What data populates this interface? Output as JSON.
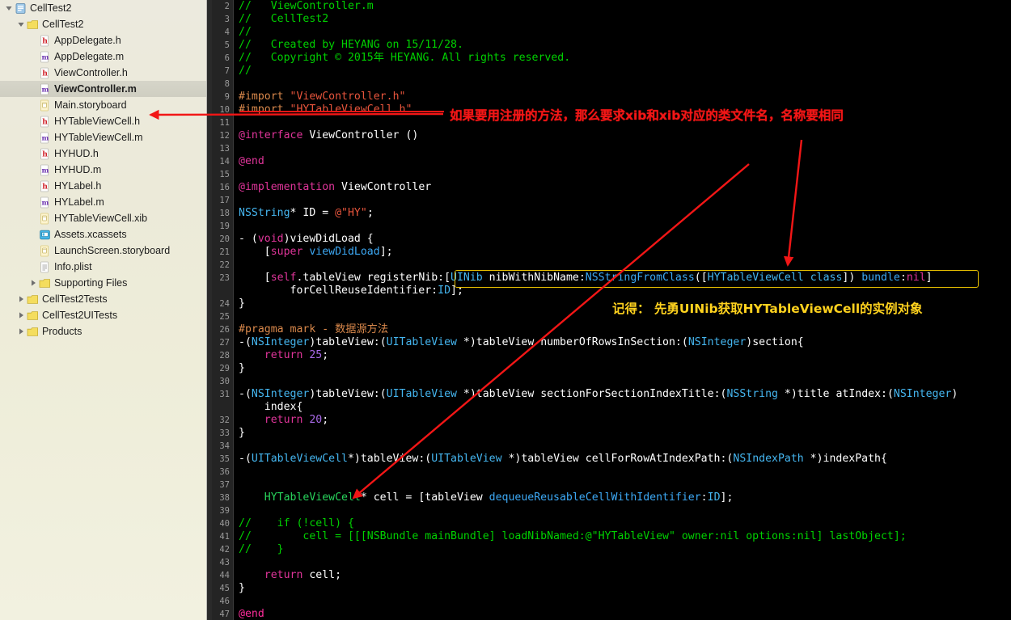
{
  "sidebar": {
    "items": [
      {
        "label": "CellTest2",
        "indent": 0,
        "twist": "down",
        "icon": "project-icon",
        "selected": false
      },
      {
        "label": "CellTest2",
        "indent": 1,
        "twist": "down",
        "icon": "folder-icon",
        "selected": false
      },
      {
        "label": "AppDelegate.h",
        "indent": 2,
        "twist": "none",
        "icon": "header-file-icon",
        "selected": false
      },
      {
        "label": "AppDelegate.m",
        "indent": 2,
        "twist": "none",
        "icon": "source-file-icon",
        "selected": false
      },
      {
        "label": "ViewController.h",
        "indent": 2,
        "twist": "none",
        "icon": "header-file-icon",
        "selected": false
      },
      {
        "label": "ViewController.m",
        "indent": 2,
        "twist": "none",
        "icon": "source-file-icon",
        "selected": true
      },
      {
        "label": "Main.storyboard",
        "indent": 2,
        "twist": "none",
        "icon": "storyboard-file-icon",
        "selected": false
      },
      {
        "label": "HYTableViewCell.h",
        "indent": 2,
        "twist": "none",
        "icon": "header-file-icon",
        "selected": false
      },
      {
        "label": "HYTableViewCell.m",
        "indent": 2,
        "twist": "none",
        "icon": "source-file-icon",
        "selected": false
      },
      {
        "label": "HYHUD.h",
        "indent": 2,
        "twist": "none",
        "icon": "header-file-icon",
        "selected": false
      },
      {
        "label": "HYHUD.m",
        "indent": 2,
        "twist": "none",
        "icon": "source-file-icon",
        "selected": false
      },
      {
        "label": "HYLabel.h",
        "indent": 2,
        "twist": "none",
        "icon": "header-file-icon",
        "selected": false
      },
      {
        "label": "HYLabel.m",
        "indent": 2,
        "twist": "none",
        "icon": "source-file-icon",
        "selected": false
      },
      {
        "label": "HYTableViewCell.xib",
        "indent": 2,
        "twist": "none",
        "icon": "xib-file-icon",
        "selected": false
      },
      {
        "label": "Assets.xcassets",
        "indent": 2,
        "twist": "none",
        "icon": "assets-catalog-icon",
        "selected": false
      },
      {
        "label": "LaunchScreen.storyboard",
        "indent": 2,
        "twist": "none",
        "icon": "storyboard-file-icon",
        "selected": false
      },
      {
        "label": "Info.plist",
        "indent": 2,
        "twist": "none",
        "icon": "plist-file-icon",
        "selected": false
      },
      {
        "label": "Supporting Files",
        "indent": 2,
        "twist": "right",
        "icon": "folder-icon",
        "selected": false
      },
      {
        "label": "CellTest2Tests",
        "indent": 1,
        "twist": "right",
        "icon": "folder-icon",
        "selected": false
      },
      {
        "label": "CellTest2UITests",
        "indent": 1,
        "twist": "right",
        "icon": "folder-icon",
        "selected": false
      },
      {
        "label": "Products",
        "indent": 1,
        "twist": "right",
        "icon": "folder-icon",
        "selected": false
      }
    ]
  },
  "editor": {
    "first_line_number": 2,
    "last_line_number": 47,
    "lines": [
      {
        "n": 2,
        "tokens": [
          {
            "t": "//   ViewController.m",
            "c": "c-com"
          }
        ]
      },
      {
        "n": 3,
        "tokens": [
          {
            "t": "//   CellTest2",
            "c": "c-com"
          }
        ]
      },
      {
        "n": 4,
        "tokens": [
          {
            "t": "//",
            "c": "c-com"
          }
        ]
      },
      {
        "n": 5,
        "tokens": [
          {
            "t": "//   Created by HEYANG on 15/11/28.",
            "c": "c-com"
          }
        ]
      },
      {
        "n": 6,
        "tokens": [
          {
            "t": "//   Copyright © 2015年 HEYANG. All rights reserved.",
            "c": "c-com"
          }
        ]
      },
      {
        "n": 7,
        "tokens": [
          {
            "t": "//",
            "c": "c-com"
          }
        ]
      },
      {
        "n": 8,
        "tokens": []
      },
      {
        "n": 9,
        "tokens": [
          {
            "t": "#import ",
            "c": "c-pre"
          },
          {
            "t": "\"ViewController.h\"",
            "c": "c-str"
          }
        ]
      },
      {
        "n": 10,
        "tokens": [
          {
            "t": "#import ",
            "c": "c-pre"
          },
          {
            "t": "\"HYTableViewCell.h\"",
            "c": "c-str"
          }
        ]
      },
      {
        "n": 11,
        "tokens": []
      },
      {
        "n": 12,
        "tokens": [
          {
            "t": "@interface ",
            "c": "c-kw"
          },
          {
            "t": "ViewController ()",
            "c": "c-plain"
          }
        ]
      },
      {
        "n": 13,
        "tokens": []
      },
      {
        "n": 14,
        "tokens": [
          {
            "t": "@end",
            "c": "c-kw"
          }
        ]
      },
      {
        "n": 15,
        "tokens": []
      },
      {
        "n": 16,
        "tokens": [
          {
            "t": "@implementation ",
            "c": "c-kw"
          },
          {
            "t": "ViewController",
            "c": "c-plain"
          }
        ]
      },
      {
        "n": 17,
        "tokens": []
      },
      {
        "n": 18,
        "tokens": [
          {
            "t": "NSString",
            "c": "c-type"
          },
          {
            "t": "* ID = ",
            "c": "c-plain"
          },
          {
            "t": "@\"HY\"",
            "c": "c-str"
          },
          {
            "t": ";",
            "c": "c-plain"
          }
        ]
      },
      {
        "n": 19,
        "tokens": []
      },
      {
        "n": 20,
        "tokens": [
          {
            "t": "- (",
            "c": "c-plain"
          },
          {
            "t": "void",
            "c": "c-kw"
          },
          {
            "t": ")viewDidLoad {",
            "c": "c-plain"
          }
        ]
      },
      {
        "n": 21,
        "tokens": [
          {
            "t": "    [",
            "c": "c-plain"
          },
          {
            "t": "super ",
            "c": "c-kw"
          },
          {
            "t": "viewDidLoad",
            "c": "c-meth"
          },
          {
            "t": "];",
            "c": "c-plain"
          }
        ]
      },
      {
        "n": 22,
        "tokens": []
      },
      {
        "n": 23,
        "tokens": [
          {
            "t": "    [",
            "c": "c-plain"
          },
          {
            "t": "self",
            "c": "c-kw"
          },
          {
            "t": ".tableView registerNib:[",
            "c": "c-plain"
          },
          {
            "t": "UINib",
            "c": "c-type"
          },
          {
            "t": " nibWithNibName:",
            "c": "c-plain"
          },
          {
            "t": "NSStringFromClass",
            "c": "c-meth"
          },
          {
            "t": "([",
            "c": "c-plain"
          },
          {
            "t": "HYTableViewCell class",
            "c": "c-type"
          },
          {
            "t": "]) ",
            "c": "c-plain"
          },
          {
            "t": "bundle",
            "c": "c-meth"
          },
          {
            "t": ":",
            "c": "c-plain"
          },
          {
            "t": "nil",
            "c": "c-kw"
          },
          {
            "t": "]",
            "c": "c-plain"
          }
        ]
      },
      {
        "n": 0,
        "tokens": [
          {
            "t": "        forCellReuseIdentifier:",
            "c": "c-plain"
          },
          {
            "t": "ID",
            "c": "c-type"
          },
          {
            "t": "];",
            "c": "c-plain"
          }
        ]
      },
      {
        "n": 24,
        "tokens": [
          {
            "t": "}",
            "c": "c-plain"
          }
        ]
      },
      {
        "n": 25,
        "tokens": []
      },
      {
        "n": 26,
        "tokens": [
          {
            "t": "#pragma mark - 数据源方法",
            "c": "c-pre"
          }
        ]
      },
      {
        "n": 27,
        "tokens": [
          {
            "t": "-(",
            "c": "c-plain"
          },
          {
            "t": "NSInteger",
            "c": "c-type"
          },
          {
            "t": ")tableView:(",
            "c": "c-plain"
          },
          {
            "t": "UITableView",
            "c": "c-type"
          },
          {
            "t": " *)tableView numberOfRowsInSection:(",
            "c": "c-plain"
          },
          {
            "t": "NSInteger",
            "c": "c-type"
          },
          {
            "t": ")section{",
            "c": "c-plain"
          }
        ]
      },
      {
        "n": 28,
        "tokens": [
          {
            "t": "    return ",
            "c": "c-kw"
          },
          {
            "t": "25",
            "c": "c-num"
          },
          {
            "t": ";",
            "c": "c-plain"
          }
        ]
      },
      {
        "n": 29,
        "tokens": [
          {
            "t": "}",
            "c": "c-plain"
          }
        ]
      },
      {
        "n": 30,
        "tokens": []
      },
      {
        "n": 31,
        "tokens": [
          {
            "t": "-(",
            "c": "c-plain"
          },
          {
            "t": "NSInteger",
            "c": "c-type"
          },
          {
            "t": ")tableView:(",
            "c": "c-plain"
          },
          {
            "t": "UITableView",
            "c": "c-type"
          },
          {
            "t": " *)tableView sectionForSectionIndexTitle:(",
            "c": "c-plain"
          },
          {
            "t": "NSString",
            "c": "c-type"
          },
          {
            "t": " *)title atIndex:(",
            "c": "c-plain"
          },
          {
            "t": "NSInteger",
            "c": "c-type"
          },
          {
            "t": ")",
            "c": "c-plain"
          }
        ]
      },
      {
        "n": 0,
        "tokens": [
          {
            "t": "    index{",
            "c": "c-plain"
          }
        ]
      },
      {
        "n": 32,
        "tokens": [
          {
            "t": "    return ",
            "c": "c-kw"
          },
          {
            "t": "20",
            "c": "c-num"
          },
          {
            "t": ";",
            "c": "c-plain"
          }
        ]
      },
      {
        "n": 33,
        "tokens": [
          {
            "t": "}",
            "c": "c-plain"
          }
        ]
      },
      {
        "n": 34,
        "tokens": []
      },
      {
        "n": 35,
        "tokens": [
          {
            "t": "-(",
            "c": "c-plain"
          },
          {
            "t": "UITableViewCell",
            "c": "c-type"
          },
          {
            "t": "*)tableView:(",
            "c": "c-plain"
          },
          {
            "t": "UITableView",
            "c": "c-type"
          },
          {
            "t": " *)tableView cellForRowAtIndexPath:(",
            "c": "c-plain"
          },
          {
            "t": "NSIndexPath",
            "c": "c-type"
          },
          {
            "t": " *)indexPath{",
            "c": "c-plain"
          }
        ]
      },
      {
        "n": 36,
        "tokens": []
      },
      {
        "n": 37,
        "tokens": []
      },
      {
        "n": 38,
        "tokens": [
          {
            "t": "    ",
            "c": "c-plain"
          },
          {
            "t": "HYTableViewCell",
            "c": "c-green"
          },
          {
            "t": "* cell = [tableView ",
            "c": "c-plain"
          },
          {
            "t": "dequeueReusableCellWithIdentifier",
            "c": "c-meth"
          },
          {
            "t": ":",
            "c": "c-plain"
          },
          {
            "t": "ID",
            "c": "c-type"
          },
          {
            "t": "];",
            "c": "c-plain"
          }
        ]
      },
      {
        "n": 39,
        "tokens": []
      },
      {
        "n": 40,
        "tokens": [
          {
            "t": "//    if (!cell) {",
            "c": "c-com"
          }
        ]
      },
      {
        "n": 41,
        "tokens": [
          {
            "t": "//        cell = [[[NSBundle mainBundle] loadNibNamed:@\"HYTableView\" owner:nil options:nil] lastObject];",
            "c": "c-com"
          }
        ]
      },
      {
        "n": 42,
        "tokens": [
          {
            "t": "//    }",
            "c": "c-com"
          }
        ]
      },
      {
        "n": 43,
        "tokens": []
      },
      {
        "n": 44,
        "tokens": [
          {
            "t": "    return ",
            "c": "c-kw"
          },
          {
            "t": "cell;",
            "c": "c-plain"
          }
        ]
      },
      {
        "n": 45,
        "tokens": [
          {
            "t": "}",
            "c": "c-plain"
          }
        ]
      },
      {
        "n": 46,
        "tokens": []
      },
      {
        "n": 47,
        "tokens": [
          {
            "t": "@end",
            "c": "c-pink"
          }
        ]
      }
    ]
  },
  "annotations": {
    "red_note": "如果要用注册的方法，那么要求xib和xib对应的类文件名，名称要相同",
    "yellow_note": "记得： 先勇UINib获取HYTableViewCell的实例对象"
  },
  "colors": {
    "annotation_red": "#f21616",
    "annotation_yellow": "#ffd21e",
    "highlight_border": "#e8c000",
    "editor_background": "#000000",
    "sidebar_background": "#ecead9",
    "selection_background": "#d2d1c4"
  }
}
